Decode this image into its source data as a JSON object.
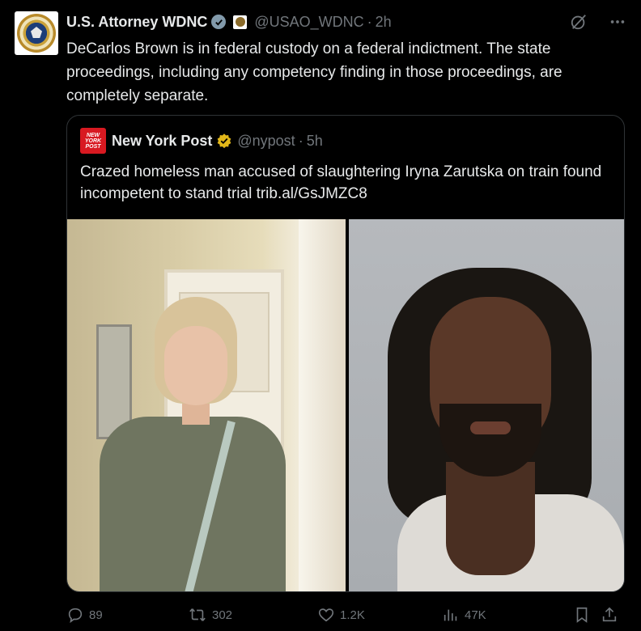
{
  "post": {
    "author_name": "U.S. Attorney WDNC",
    "handle": "@USAO_WDNC",
    "separator": "·",
    "time": "2h",
    "text": "DeCarlos Brown is in federal custody on a federal indictment. The state proceedings, including any competency finding in those proceedings, are completely separate."
  },
  "quoted_post": {
    "logo_text": "NEW YORK POST",
    "author_name": "New York Post",
    "handle": "@nypost",
    "separator": "·",
    "time": "5h",
    "text": "Crazed homeless man accused of slaughtering Iryna Zarutska on train found incompetent to stand trial trib.al/GsJMZC8"
  },
  "actions": {
    "replies": "89",
    "reposts": "302",
    "likes": "1.2K",
    "views": "47K"
  },
  "icons": {
    "avatar": "doj-seal-icon",
    "government_badge": "gray-verified-badge-icon",
    "affiliate_badge": "doj-affiliate-badge-icon",
    "grok": "grok-icon",
    "more": "more-icon",
    "quoted_badge": "gold-verified-badge-icon",
    "reply": "reply-icon",
    "repost": "repost-icon",
    "like": "like-icon",
    "views": "views-icon",
    "bookmark": "bookmark-icon",
    "share": "share-icon"
  },
  "colors": {
    "background": "#000000",
    "text": "#e7e9ea",
    "muted": "#71767b",
    "border": "#2f3336",
    "gov_badge": "#829aab",
    "gold_badge": "#e2b719",
    "nypost_red": "#d81921"
  }
}
